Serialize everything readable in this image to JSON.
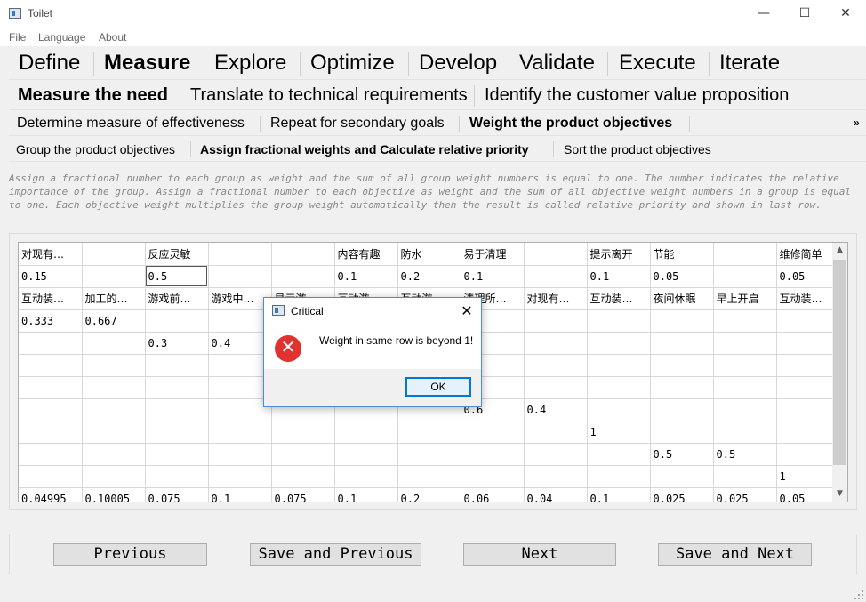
{
  "window": {
    "title": "Toilet",
    "minimize": "—",
    "maximize": "☐",
    "close": "✕"
  },
  "menu": [
    "File",
    "Language",
    "About"
  ],
  "stage_tabs": [
    "Define",
    "Measure",
    "Explore",
    "Optimize",
    "Develop",
    "Validate",
    "Execute",
    "Iterate"
  ],
  "step_tabs": [
    "Measure the need",
    "Translate to technical requirements",
    "Identify the customer value proposition"
  ],
  "substep_tabs": [
    "Determine measure of effectiveness",
    "Repeat for secondary goals",
    "Weight the product objectives"
  ],
  "substep_more": "»",
  "task_tabs": [
    "Group the product objectives",
    "Assign fractional weights and Calculate relative priority",
    "Sort the product objectives"
  ],
  "description": "Assign a fractional number to each group as weight and the sum of all group weight numbers is equal to one. The number indicates the relative importance of the group. Assign a fractional number to each objective as weight and the sum of all objective weight numbers in a group is equal to one. Each objective weight multiplies the group weight automatically then the result is called relative priority and shown in last row.",
  "table": {
    "rows": [
      [
        "对现有…",
        "",
        "反应灵敏",
        "",
        "",
        "内容有趣",
        "防水",
        "易于清理",
        "",
        "提示离开",
        "节能",
        "",
        "维修简单"
      ],
      [
        "0.15",
        "",
        "0.5",
        "",
        "",
        "0.1",
        "0.2",
        "0.1",
        "",
        "0.1",
        "0.05",
        "",
        "0.05"
      ],
      [
        "互动装…",
        "加工的…",
        "游戏前…",
        "游戏中…",
        "显示游…",
        "互动游…",
        "互动游…",
        "清理所…",
        "对现有…",
        "互动装…",
        "夜间休眠",
        "早上开启",
        "互动装…"
      ],
      [
        "0.333",
        "0.667",
        "",
        "",
        "",
        "",
        "",
        "",
        "",
        "",
        "",
        "",
        ""
      ],
      [
        "",
        "",
        "0.3",
        "0.4",
        "",
        "",
        "",
        "",
        "",
        "",
        "",
        "",
        ""
      ],
      [
        "",
        "",
        "",
        "",
        "",
        "",
        "",
        "",
        "",
        "",
        "",
        "",
        ""
      ],
      [
        "",
        "",
        "",
        "",
        "",
        "",
        "",
        "",
        "",
        "",
        "",
        "",
        ""
      ],
      [
        "",
        "",
        "",
        "",
        "",
        "",
        "",
        "0.6",
        "0.4",
        "",
        "",
        "",
        ""
      ],
      [
        "",
        "",
        "",
        "",
        "",
        "",
        "",
        "",
        "",
        "1",
        "",
        "",
        ""
      ],
      [
        "",
        "",
        "",
        "",
        "",
        "",
        "",
        "",
        "",
        "",
        "0.5",
        "0.5",
        ""
      ],
      [
        "",
        "",
        "",
        "",
        "",
        "",
        "",
        "",
        "",
        "",
        "",
        "",
        "1"
      ],
      [
        "0.04995",
        "0.10005",
        "0.075",
        "0.1",
        "0.075",
        "0.1",
        "0.2",
        "0.06",
        "0.04",
        "0.1",
        "0.025",
        "0.025",
        "0.05"
      ]
    ]
  },
  "buttons": {
    "previous": "Previous",
    "save_previous": "Save and Previous",
    "next": "Next",
    "save_next": "Save and Next"
  },
  "dialog": {
    "title": "Critical",
    "close": "✕",
    "icon": "✕",
    "message": "Weight in same row is beyond 1!",
    "ok": "OK"
  }
}
